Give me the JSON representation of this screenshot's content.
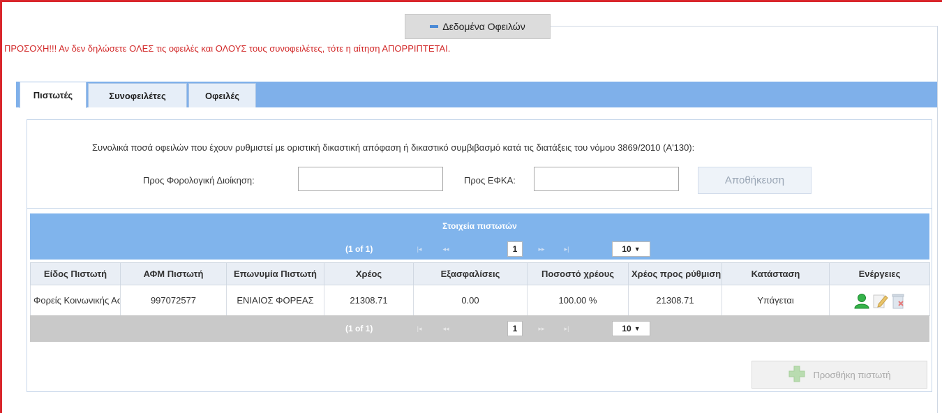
{
  "legend": {
    "title": "Δεδομένα Οφειλών"
  },
  "warning": "ΠΡΟΣΟΧΗ!!! Αν δεν δηλώσετε ΟΛΕΣ τις οφειλές και ΟΛΟΥΣ τους συνοφειλέτες, τότε η αίτηση ΑΠΟΡΡΙΠΤΕΤΑΙ.",
  "tabs": [
    {
      "label": "Πιστωτές",
      "active": true
    },
    {
      "label": "Συνοφειλέτες",
      "active": false
    },
    {
      "label": "Οφειλές",
      "active": false
    }
  ],
  "summary": {
    "text": "Συνολικά ποσά οφειλών που έχουν ρυθμιστεί με οριστική δικαστική απόφαση ή δικαστικό συμβιβασμό κατά τις διατάξεις του νόμου 3869/2010 (Α'130):",
    "tax_label": "Προς Φορολογική Διοίκηση:",
    "tax_value": "",
    "efka_label": "Προς ΕΦΚΑ:",
    "efka_value": "",
    "save_label": "Αποθήκευση"
  },
  "table": {
    "title": "Στοιχεία πιστωτών",
    "pager": {
      "count": "(1 of 1)",
      "current_page": "1",
      "rows_per_page": "10",
      "first": "|◂",
      "prev": "◂◂",
      "next": "▸▸",
      "last": "▸|",
      "caret": "▼"
    },
    "columns": [
      "Είδος Πιστωτή",
      "ΑΦΜ Πιστωτή",
      "Επωνυμία Πιστωτή",
      "Χρέος",
      "Εξασφαλίσεις",
      "Ποσοστό χρέους",
      "Χρέος προς ρύθμιση",
      "Κατάσταση",
      "Ενέργειες"
    ],
    "rows": [
      {
        "kind": "Φορείς Κοινωνικής Ασφάλισης",
        "afm": "997072577",
        "name": "ΕΝΙΑΙΟΣ ΦΟΡΕΑΣ",
        "debt": "21308.71",
        "collateral": "0.00",
        "percent": "100.00 %",
        "debt_to_settle": "21308.71",
        "status": "Υπάγεται"
      }
    ]
  },
  "add_button": "Προσθήκη πιστωτή",
  "icons": {
    "legend": "minus-icon",
    "row_actions": [
      "user-icon",
      "edit-icon",
      "delete-icon"
    ],
    "add": "plus-icon"
  },
  "colors": {
    "accent": "#80b4ec",
    "warning": "#d22a2a",
    "frame": "#d9262c"
  }
}
